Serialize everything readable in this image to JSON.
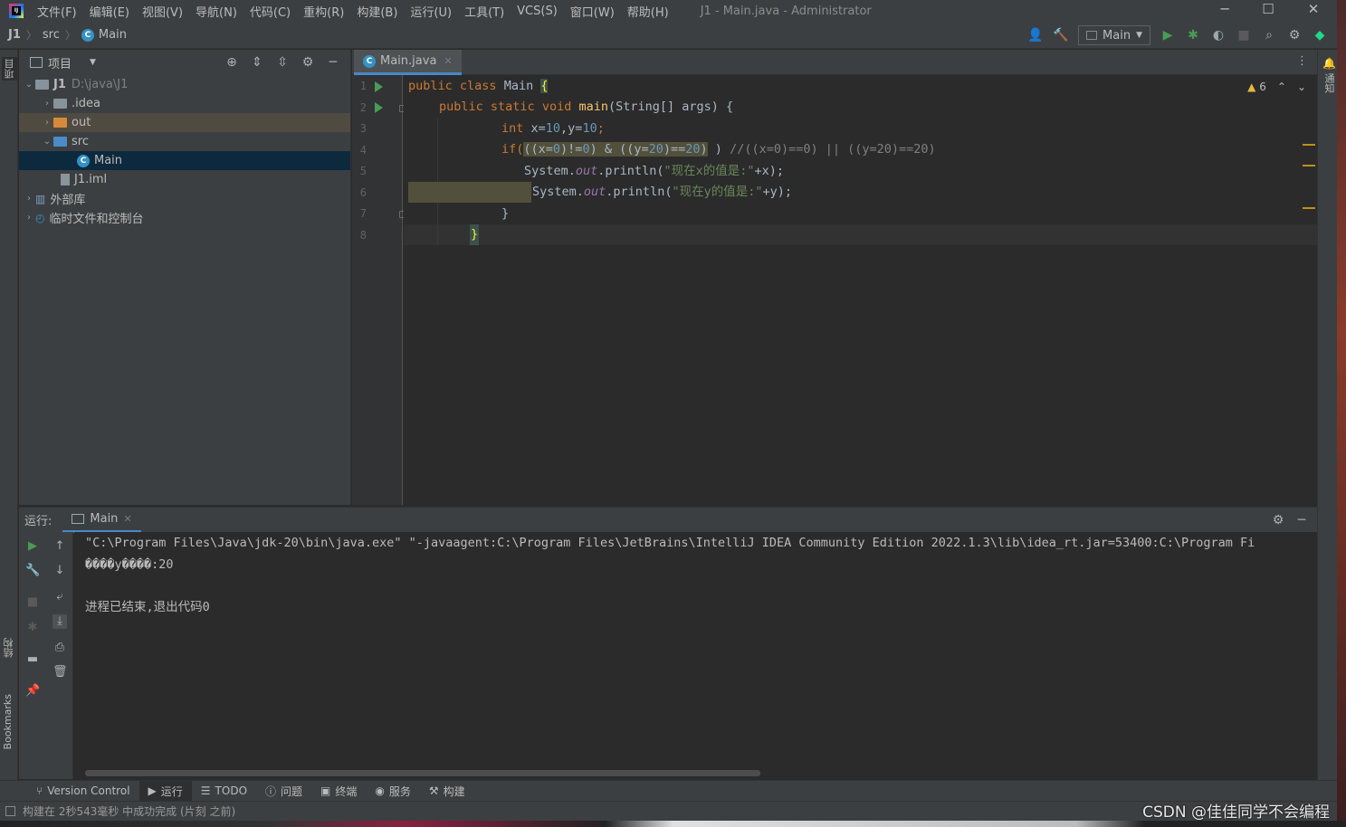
{
  "app": {
    "logo_text": "IJ",
    "window_title": "J1 - Main.java - Administrator"
  },
  "menu": [
    "文件(F)",
    "编辑(E)",
    "视图(V)",
    "导航(N)",
    "代码(C)",
    "重构(R)",
    "构建(B)",
    "运行(U)",
    "工具(T)",
    "VCS(S)",
    "窗口(W)",
    "帮助(H)"
  ],
  "window_controls": {
    "minimize": "─",
    "maximize": "☐",
    "close": "✕"
  },
  "breadcrumb": {
    "project": "J1",
    "folder": "src",
    "file": "Main"
  },
  "run_config": {
    "label": "Main"
  },
  "project_panel": {
    "title": "项目",
    "tree": {
      "root": "J1",
      "root_path": "D:\\java\\J1",
      "idea": ".idea",
      "out": "out",
      "src": "src",
      "main": "Main",
      "iml": "J1.iml",
      "external_libs": "外部库",
      "scratches": "临时文件和控制台"
    }
  },
  "left_stripe": {
    "project": "项目",
    "structure": "结构",
    "bookmarks": "Bookmarks"
  },
  "right_stripe": {
    "notifications": "通知"
  },
  "editor": {
    "tab_label": "Main.java",
    "warning_count": "6",
    "line_numbers": [
      "1",
      "2",
      "3",
      "4",
      "5",
      "6",
      "7",
      "8"
    ],
    "lines": {
      "l1": {
        "kw1": "public ",
        "kw2": "class ",
        "name": "Main ",
        "brace": "{"
      },
      "l2": {
        "kw1": "public ",
        "kw2": "static ",
        "kw3": "void ",
        "fn": "main",
        "rest": "(String[] args) {"
      },
      "l3": {
        "kw": "int ",
        "a": "x=",
        "n1": "10",
        "b": ",y=",
        "n2": "10",
        "c": ";"
      },
      "l4": {
        "a": "if(",
        "h1": "((x=",
        "n1": "0",
        "h2": ")!=",
        "n2": "0",
        "h3": ") & ((y=",
        "n3": "20",
        "h4": ")==",
        "n4": "20",
        "h5": ")",
        "b": " ) ",
        "cmt": "//((x=0)==0) || ((y=20)==20)"
      },
      "l5": {
        "a": "System.",
        "fld": "out",
        "b": ".println(",
        "str": "\"现在x的值是:\"",
        "c": "+x);"
      },
      "l6": {
        "a": "System.",
        "fld": "out",
        "b": ".println(",
        "str": "\"现在y的值是:\"",
        "c": "+y);"
      },
      "l7": {
        "text": "}"
      },
      "l8": {
        "text": "}"
      }
    }
  },
  "run_panel": {
    "label": "运行:",
    "tab_label": "Main",
    "console": [
      "\"C:\\Program Files\\Java\\jdk-20\\bin\\java.exe\" \"-javaagent:C:\\Program Files\\JetBrains\\IntelliJ IDEA Community Edition 2022.1.3\\lib\\idea_rt.jar=53400:C:\\Program Fi",
      "����y����:20",
      "",
      "进程已结束,退出代码0"
    ]
  },
  "tool_windows": [
    "Version Control",
    "运行",
    "TODO",
    "问题",
    "终端",
    "服务",
    "构建"
  ],
  "status": {
    "text": "构建在 2秒543毫秒 中成功完成 (片刻 之前)"
  },
  "watermark": "CSDN @佳佳同学不会编程"
}
